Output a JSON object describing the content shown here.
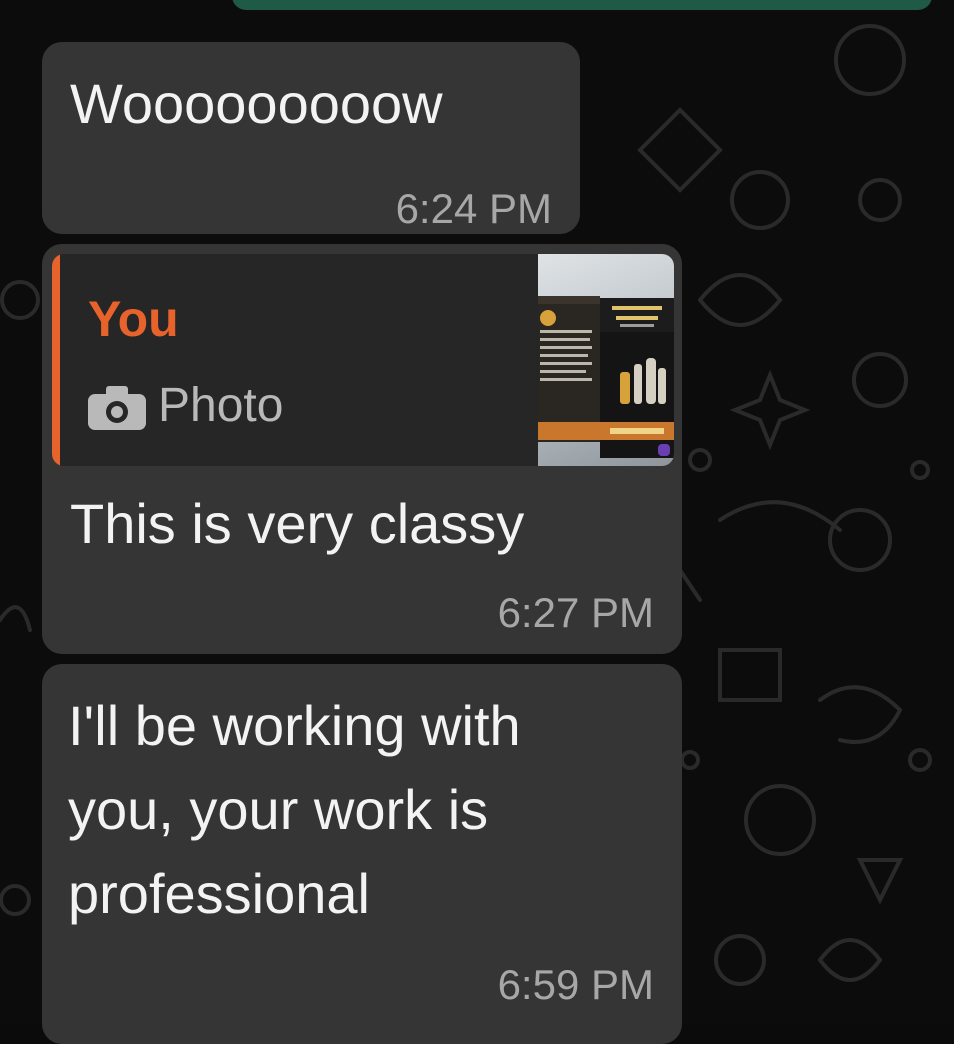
{
  "colors": {
    "bubble_bg": "#353535",
    "reply_accent": "#e8622b",
    "sent_bubble": "#1e5a45",
    "time_text": "#a7a7a7"
  },
  "messages": [
    {
      "text": "Wooooooooow",
      "time": "6:24 PM"
    },
    {
      "quote": {
        "author": "You",
        "type_icon": "camera-icon",
        "type_label": "Photo"
      },
      "text": "This is very classy",
      "time": "6:27 PM"
    },
    {
      "text": "I'll be working with\nyou, your work is\nprofessional",
      "time": "6:59 PM"
    }
  ]
}
